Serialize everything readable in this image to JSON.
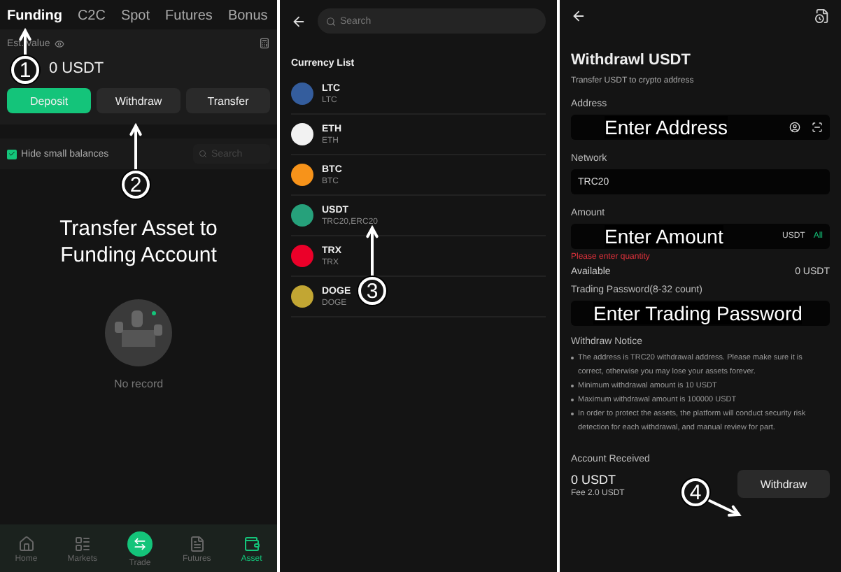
{
  "funding_screen": {
    "tabs": [
      {
        "label": "Funding",
        "selected": true
      },
      {
        "label": "C2C",
        "selected": false
      },
      {
        "label": "Spot",
        "selected": false
      },
      {
        "label": "Futures",
        "selected": false
      },
      {
        "label": "Bonus",
        "selected": false
      }
    ],
    "est_value_label": "Est. value",
    "balance": "0 USDT",
    "actions": [
      {
        "label": "Deposit",
        "selected": true
      },
      {
        "label": "Withdraw",
        "selected": false
      },
      {
        "label": "Transfer",
        "selected": false
      }
    ],
    "hide_small_balances": {
      "label": "Hide small balances",
      "checked": true
    },
    "search": {
      "placeholder": "Search"
    },
    "caption": "Transfer Asset to Funding Account",
    "empty_text": "No record",
    "nav": [
      {
        "label": "Home",
        "kind": "home",
        "selected": false
      },
      {
        "label": "Markets",
        "kind": "markets",
        "selected": false
      },
      {
        "label": "Trade",
        "kind": "trade",
        "selected": false
      },
      {
        "label": "Futures",
        "kind": "futures",
        "selected": false
      },
      {
        "label": "Asset",
        "kind": "asset",
        "selected": true
      }
    ]
  },
  "currency_screen": {
    "search": {
      "placeholder": "Search"
    },
    "list_title": "Currency List",
    "currencies": [
      {
        "symbol": "LTC",
        "network": "LTC",
        "color": "#345d9d"
      },
      {
        "symbol": "ETH",
        "network": "ETH",
        "color": "#f2f2f2"
      },
      {
        "symbol": "BTC",
        "network": "BTC",
        "color": "#f7931a"
      },
      {
        "symbol": "USDT",
        "network": "TRC20,ERC20",
        "color": "#26a17b"
      },
      {
        "symbol": "TRX",
        "network": "TRX",
        "color": "#eb0029"
      },
      {
        "symbol": "DOGE",
        "network": "DOGE",
        "color": "#c2a633"
      }
    ]
  },
  "withdraw_screen": {
    "title": "Withdrawl USDT",
    "subtitle": "Transfer USDT to crypto address",
    "address": {
      "label": "Address",
      "overlay": "Enter Address"
    },
    "network": {
      "label": "Network",
      "value": "TRC20"
    },
    "amount": {
      "label": "Amount",
      "overlay": "Enter Amount",
      "unit": "USDT",
      "all": "All",
      "error": "Please enter quantity"
    },
    "available": {
      "label": "Available",
      "value": "0 USDT"
    },
    "password": {
      "label": "Trading Password(8-32 count)",
      "overlay": "Enter Trading Password"
    },
    "notice_title": "Withdraw Notice",
    "notices": [
      "The address is TRC20 withdrawal address. Please make sure it is correct, otherwise you may lose your assets forever.",
      "Minimum withdrawal amount is 10 USDT",
      "Maximum withdrawal amount is 100000 USDT",
      "In order to protect the assets, the platform will conduct security risk detection for each withdrawal, and manual review for part."
    ],
    "received_label": "Account Received",
    "received_value": "0 USDT",
    "fee": "Fee 2.0 USDT",
    "submit": "Withdraw"
  },
  "steps": [
    "1",
    "2",
    "3",
    "4"
  ]
}
